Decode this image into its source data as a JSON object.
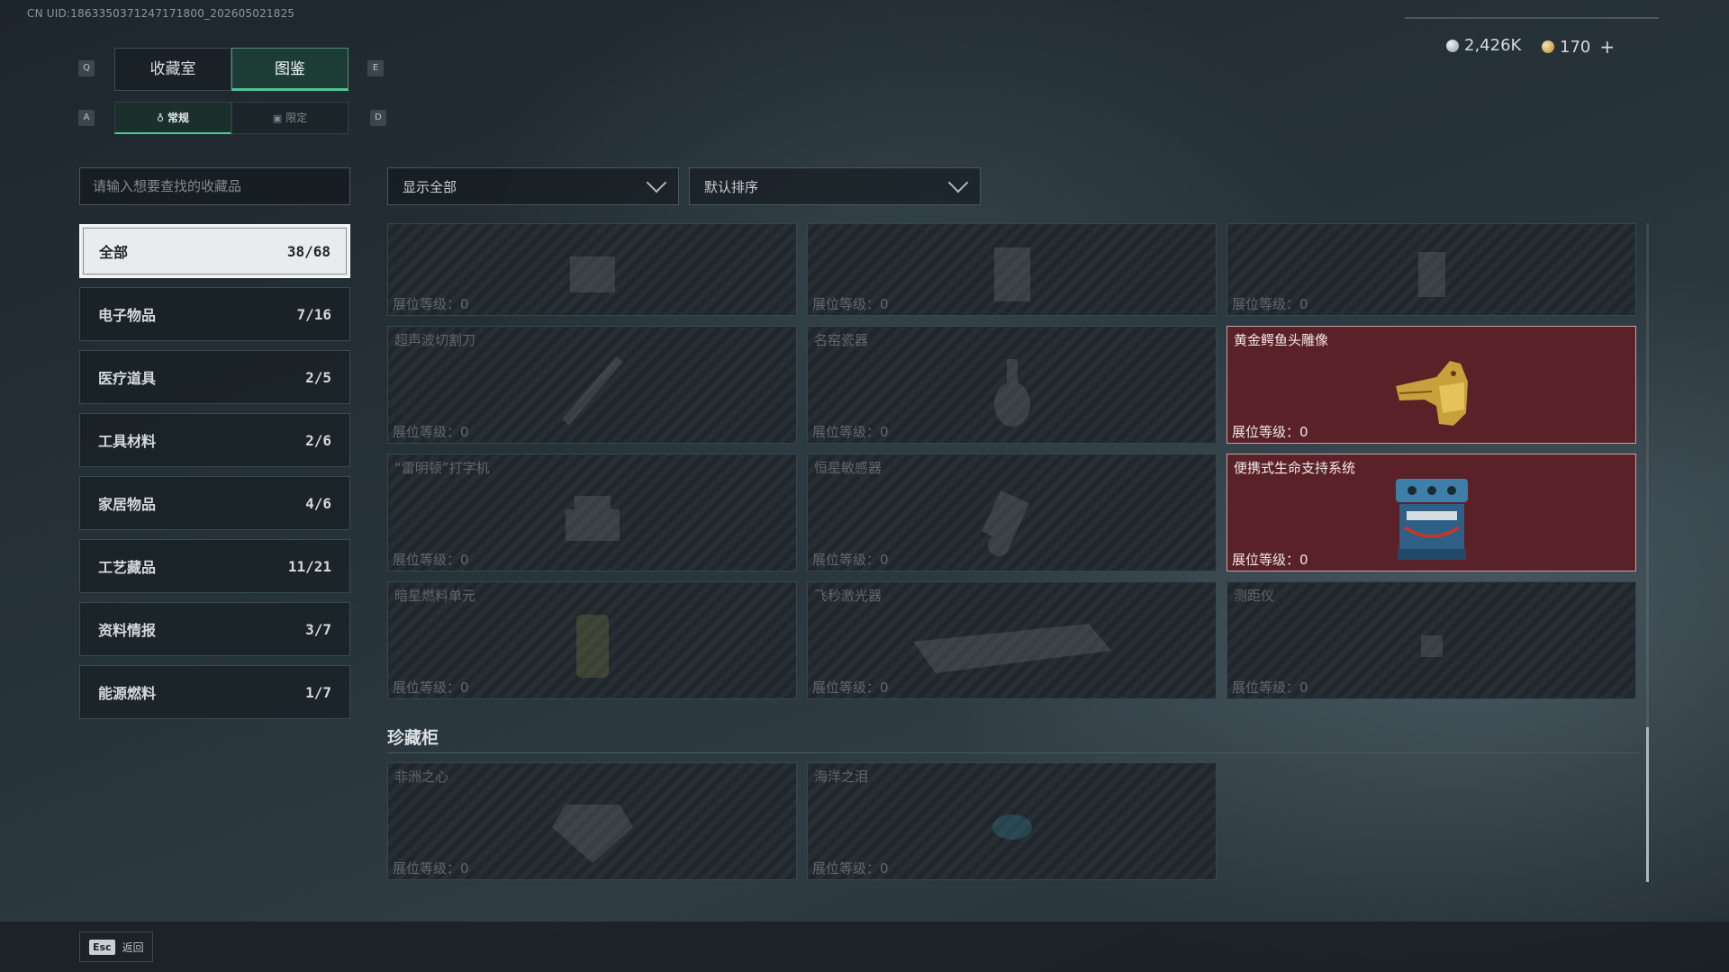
{
  "uid_text": "CN UID:1863350371247171800_202605021825",
  "keys": {
    "prev_tab": "Q",
    "next_tab": "E",
    "prev_sub": "A",
    "next_sub": "D"
  },
  "tabs": [
    {
      "label": "收藏室"
    },
    {
      "label": "图鉴"
    }
  ],
  "subtabs": [
    {
      "label": "常规"
    },
    {
      "label": "限定"
    }
  ],
  "currency": {
    "silver": "2,426K",
    "gold": "170",
    "add": "+"
  },
  "search": {
    "placeholder": "请输入想要查找的收藏品"
  },
  "categories": [
    {
      "label": "全部",
      "count": "38/68"
    },
    {
      "label": "电子物品",
      "count": "7/16"
    },
    {
      "label": "医疗道具",
      "count": "2/5"
    },
    {
      "label": "工具材料",
      "count": "2/6"
    },
    {
      "label": "家居物品",
      "count": "4/6"
    },
    {
      "label": "工艺藏品",
      "count": "11/21"
    },
    {
      "label": "资料情报",
      "count": "3/7"
    },
    {
      "label": "能源燃料",
      "count": "1/7"
    }
  ],
  "filters": {
    "show": "显示全部",
    "sort": "默认排序"
  },
  "items": [
    {
      "name": "",
      "level": "展位等级：0"
    },
    {
      "name": "",
      "level": "展位等级：0"
    },
    {
      "name": "",
      "level": "展位等级：0"
    },
    {
      "name": "超声波切割刀",
      "level": "展位等级：0"
    },
    {
      "name": "名窑瓷器",
      "level": "展位等级：0"
    },
    {
      "name": "黄金鳄鱼头雕像",
      "level": "展位等级：0"
    },
    {
      "name": "“雷明顿”打字机",
      "level": "展位等级：0"
    },
    {
      "name": "恒星敏感器",
      "level": "展位等级：0"
    },
    {
      "name": "便携式生命支持系统",
      "level": "展位等级：0"
    },
    {
      "name": "暗星燃料单元",
      "level": "展位等级：0"
    },
    {
      "name": "飞秒激光器",
      "level": "展位等级：0"
    },
    {
      "name": "测距仪",
      "level": "展位等级：0"
    }
  ],
  "cabinet": {
    "title": "珍藏柜",
    "items": [
      {
        "name": "非洲之心",
        "level": "展位等级：0"
      },
      {
        "name": "海洋之泪",
        "level": "展位等级：0"
      }
    ]
  },
  "footer": {
    "esc_key": "Esc",
    "esc_label": "返回"
  },
  "colors": {
    "accent": "#51c49a",
    "owned_card": "#5a2128",
    "selected_category": "#e8ecee"
  }
}
